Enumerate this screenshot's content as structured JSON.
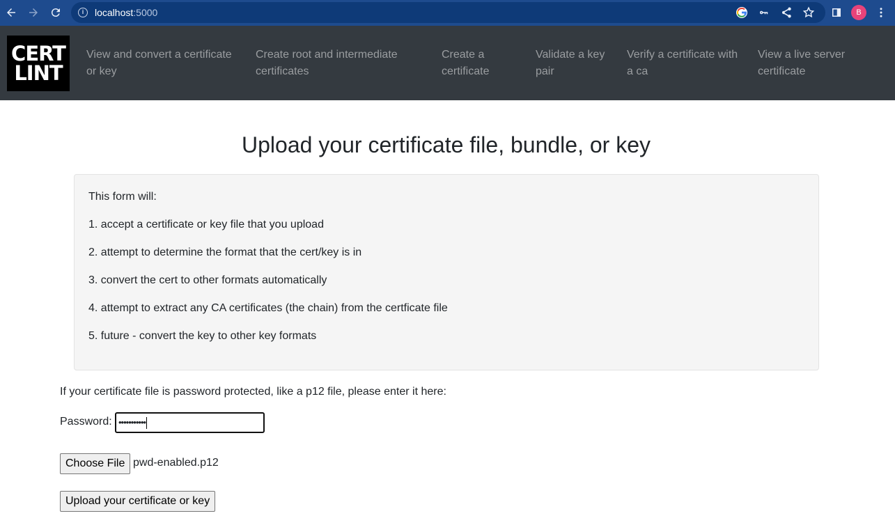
{
  "browser": {
    "url_host": "localhost",
    "url_port": ":5000",
    "profile_initial": "B"
  },
  "brand": {
    "logo_line1": "CERT",
    "logo_line2": "LINT"
  },
  "nav": {
    "items": [
      {
        "line1": "View and convert a certificate",
        "line2": "or key"
      },
      {
        "line1": "Create root and intermediate",
        "line2": "certificates"
      },
      {
        "line1": "Create a",
        "line2": "certificate"
      },
      {
        "line1": "Validate a key",
        "line2": "pair"
      },
      {
        "line1": "Verify a certificate with",
        "line2": "a ca"
      },
      {
        "line1": "View a live server",
        "line2": "certificate"
      }
    ]
  },
  "main": {
    "title": "Upload your certificate file, bundle, or key",
    "intro": "This form will:",
    "steps": [
      "1. accept a certificate or key file that you upload",
      "2. attempt to determine the format that the cert/key is in",
      "3. convert the cert to other formats automatically",
      "4. attempt to extract any CA certificates (the chain) from the certficate file",
      "5. future - convert the key to other key formats"
    ],
    "password_note": "If your certificate file is password protected, like a p12 file, please enter it here:",
    "password_label": "Password:",
    "password_value_masked": "•••••••••••",
    "choose_file_label": "Choose File",
    "file_name": "pwd-enabled.p12",
    "upload_label": "Upload your certificate or key"
  }
}
